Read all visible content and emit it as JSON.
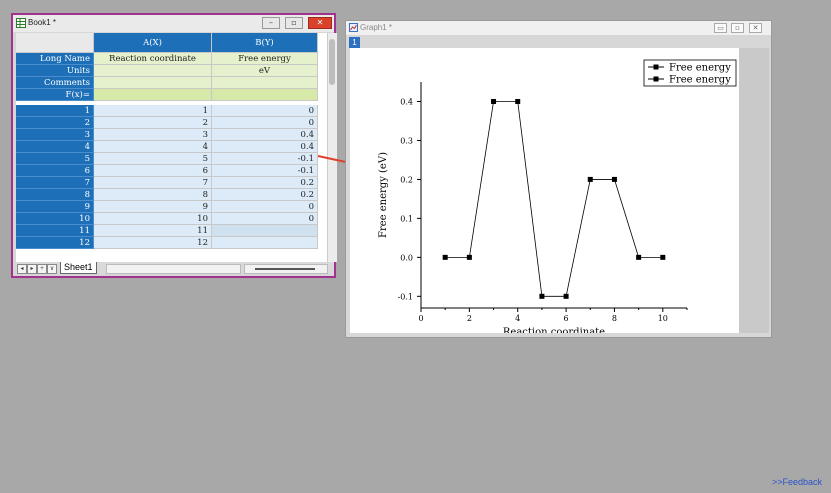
{
  "book": {
    "title": "Book1 *",
    "columns": [
      {
        "header": "A(X)",
        "long_name": "Reaction coordinate",
        "units": "",
        "comments": "",
        "fx": ""
      },
      {
        "header": "B(Y)",
        "long_name": "Free energy",
        "units": "eV",
        "comments": "",
        "fx": ""
      }
    ],
    "row_labels": {
      "long_name": "Long Name",
      "units": "Units",
      "comments": "Comments",
      "fx": "F(x)="
    },
    "rows": [
      {
        "n": "1",
        "a": "1",
        "b": "0"
      },
      {
        "n": "2",
        "a": "2",
        "b": "0"
      },
      {
        "n": "3",
        "a": "3",
        "b": "0.4"
      },
      {
        "n": "4",
        "a": "4",
        "b": "0.4"
      },
      {
        "n": "5",
        "a": "5",
        "b": "-0.1"
      },
      {
        "n": "6",
        "a": "6",
        "b": "-0.1"
      },
      {
        "n": "7",
        "a": "7",
        "b": "0.2"
      },
      {
        "n": "8",
        "a": "8",
        "b": "0.2"
      },
      {
        "n": "9",
        "a": "9",
        "b": "0"
      },
      {
        "n": "10",
        "a": "10",
        "b": "0"
      },
      {
        "n": "11",
        "a": "11",
        "b": ""
      },
      {
        "n": "12",
        "a": "12",
        "b": ""
      }
    ],
    "sheet_tab": "Sheet1",
    "nav_buttons": [
      "◂",
      "▸",
      "+",
      "∨"
    ]
  },
  "graph": {
    "title": "Graph1 *",
    "layer_label": "1",
    "window_buttons": [
      "▭",
      "▫",
      "✕"
    ]
  },
  "window_buttons": [
    "–",
    "▫",
    "✕"
  ],
  "feedback_link": ">>Feedback",
  "chart_data": {
    "type": "line",
    "x": [
      1,
      2,
      3,
      4,
      5,
      6,
      7,
      8,
      9,
      10
    ],
    "series": [
      {
        "name": "Free energy",
        "values": [
          0,
          0,
          0.4,
          0.4,
          -0.1,
          -0.1,
          0.2,
          0.2,
          0,
          0
        ]
      }
    ],
    "legend_entries": [
      "Free energy",
      "Free energy"
    ],
    "legend_position": "top-right",
    "xlabel": "Reaction coordinate",
    "ylabel": "Free energy (eV)",
    "xlim": [
      0,
      11
    ],
    "ylim": [
      -0.13,
      0.45
    ],
    "xticks": [
      "0",
      "2",
      "4",
      "6",
      "8",
      "10"
    ],
    "xtick_values": [
      0,
      2,
      4,
      6,
      8,
      10
    ],
    "yticks": [
      "-0.1",
      "0.0",
      "0.1",
      "0.2",
      "0.3",
      "0.4"
    ],
    "ytick_values": [
      -0.1,
      0,
      0.1,
      0.2,
      0.3,
      0.4
    ],
    "grid": false,
    "line_color": "#000000",
    "marker": "square"
  },
  "colors": {
    "row_header": "#1d6fb8",
    "meta_cell": "#e5f0cc",
    "data_cell": "#dcebf7",
    "book_border": "#a1338f",
    "arrow": "#e0412e"
  }
}
